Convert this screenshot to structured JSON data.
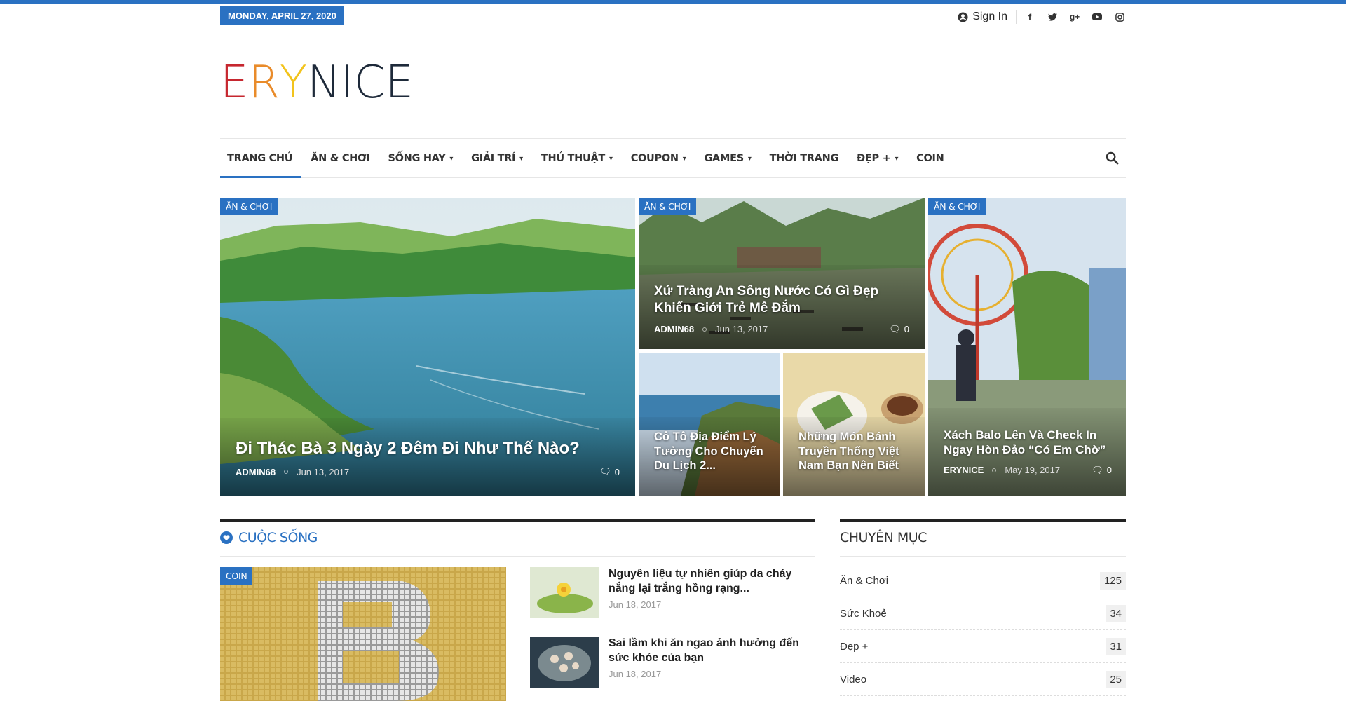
{
  "topbar": {
    "date": "MONDAY, APRIL 27, 2020",
    "signin_label": "Sign In",
    "social": [
      "facebook-icon",
      "twitter-icon",
      "google-plus-icon",
      "youtube-icon",
      "instagram-icon"
    ]
  },
  "logo": {
    "text": "ERYNICE"
  },
  "nav": {
    "items": [
      {
        "label": "TRANG CHỦ",
        "dropdown": false
      },
      {
        "label": "ĂN & CHƠI",
        "dropdown": false
      },
      {
        "label": "SỐNG HAY",
        "dropdown": true
      },
      {
        "label": "GIẢI TRÍ",
        "dropdown": true
      },
      {
        "label": "THỦ THUẬT",
        "dropdown": true
      },
      {
        "label": "COUPON",
        "dropdown": true
      },
      {
        "label": "GAMES",
        "dropdown": true
      },
      {
        "label": "THỜI TRANG",
        "dropdown": false
      },
      {
        "label": "ĐẸP +",
        "dropdown": true
      },
      {
        "label": "COIN",
        "dropdown": false
      }
    ]
  },
  "hero": {
    "main": {
      "category": "ĂN & CHƠI",
      "title": "Đi Thác Bà 3 Ngày 2 Đêm Đi Như Thế Nào?",
      "author": "ADMIN68",
      "date": "Jun 13, 2017",
      "comments": "0"
    },
    "top_mid": {
      "category": "ĂN & CHƠI",
      "title": "Xứ Tràng An Sông Nước Có Gì Đẹp Khiến Giới Trẻ Mê Đắm",
      "author": "ADMIN68",
      "date": "Jun 13, 2017",
      "comments": "0"
    },
    "small1": {
      "title": "Cô Tô Địa Điểm Lý Tưởng Cho Chuyến Du Lịch 2..."
    },
    "small2": {
      "title": "Những Món Bánh Truyền Thống Việt Nam Bạn Nên Biết"
    },
    "right": {
      "category": "ĂN & CHƠI",
      "title": "Xách Balo Lên Và Check In Ngay Hòn Đảo “Có Em Chờ”",
      "author": "ERYNICE",
      "date": "May 19, 2017",
      "comments": "0"
    }
  },
  "section": {
    "title": "CUỘC SỐNG",
    "feature_category": "COIN",
    "list": [
      {
        "title": "Nguyên liệu tự nhiên giúp da cháy nắng lại trắng hồng rạng...",
        "date": "Jun 18, 2017"
      },
      {
        "title": "Sai lầm khi ăn ngao ảnh hưởng đến sức khỏe của bạn",
        "date": "Jun 18, 2017"
      }
    ]
  },
  "sidebar": {
    "title": "CHUYÊN MỤC",
    "categories": [
      {
        "name": "Ăn & Chơi",
        "count": "125"
      },
      {
        "name": "Sức Khoẻ",
        "count": "34"
      },
      {
        "name": "Đẹp +",
        "count": "31"
      },
      {
        "name": "Video",
        "count": "25"
      }
    ]
  },
  "colors": {
    "accent": "#2a71c2"
  }
}
